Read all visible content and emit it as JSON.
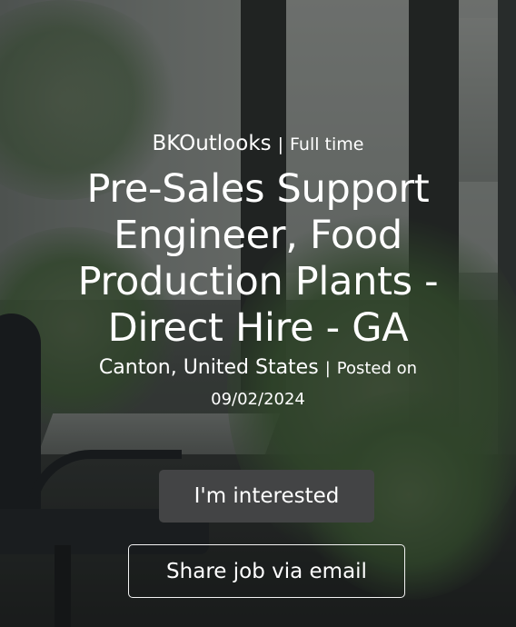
{
  "job": {
    "company": "BKOutlooks",
    "separator": "|",
    "employment_type": "Full time",
    "title": "Pre-Sales Support Engineer, Food Production Plants - Direct Hire - GA",
    "location": "Canton, United States",
    "posted_label": "Posted on",
    "posted_date": "09/02/2024"
  },
  "actions": {
    "interested_label": "I'm interested",
    "share_label": "Share job via email"
  },
  "colors": {
    "text": "#ffffff",
    "interested_button_bg": "#434445",
    "share_button_border": "#f2f2f2"
  },
  "background": {
    "description_icon": "office-photo"
  }
}
